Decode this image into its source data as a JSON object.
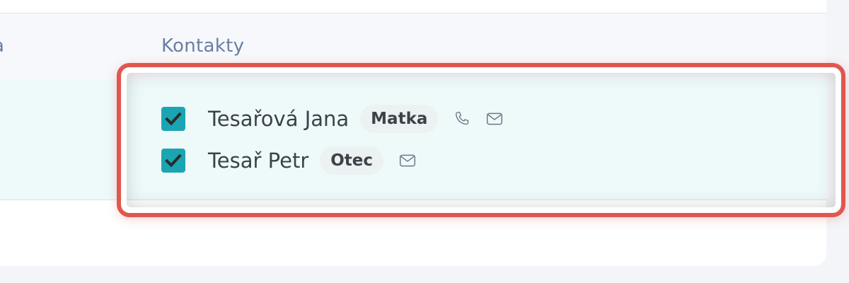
{
  "table": {
    "previous_column_header": "a",
    "contacts_column_header": "Kontakty"
  },
  "contacts": [
    {
      "name": "Tesařová Jana",
      "role": "Matka",
      "checked": true,
      "icons": [
        "phone-icon",
        "mail-icon"
      ]
    },
    {
      "name": "Tesař Petr",
      "role": "Otec",
      "checked": true,
      "icons": [
        "mail-icon"
      ]
    }
  ],
  "colors": {
    "checkbox": "#1ba5b3",
    "highlight_border": "#e0574f",
    "header_text": "#6b7fa4",
    "row_background": "#eef9fa"
  }
}
